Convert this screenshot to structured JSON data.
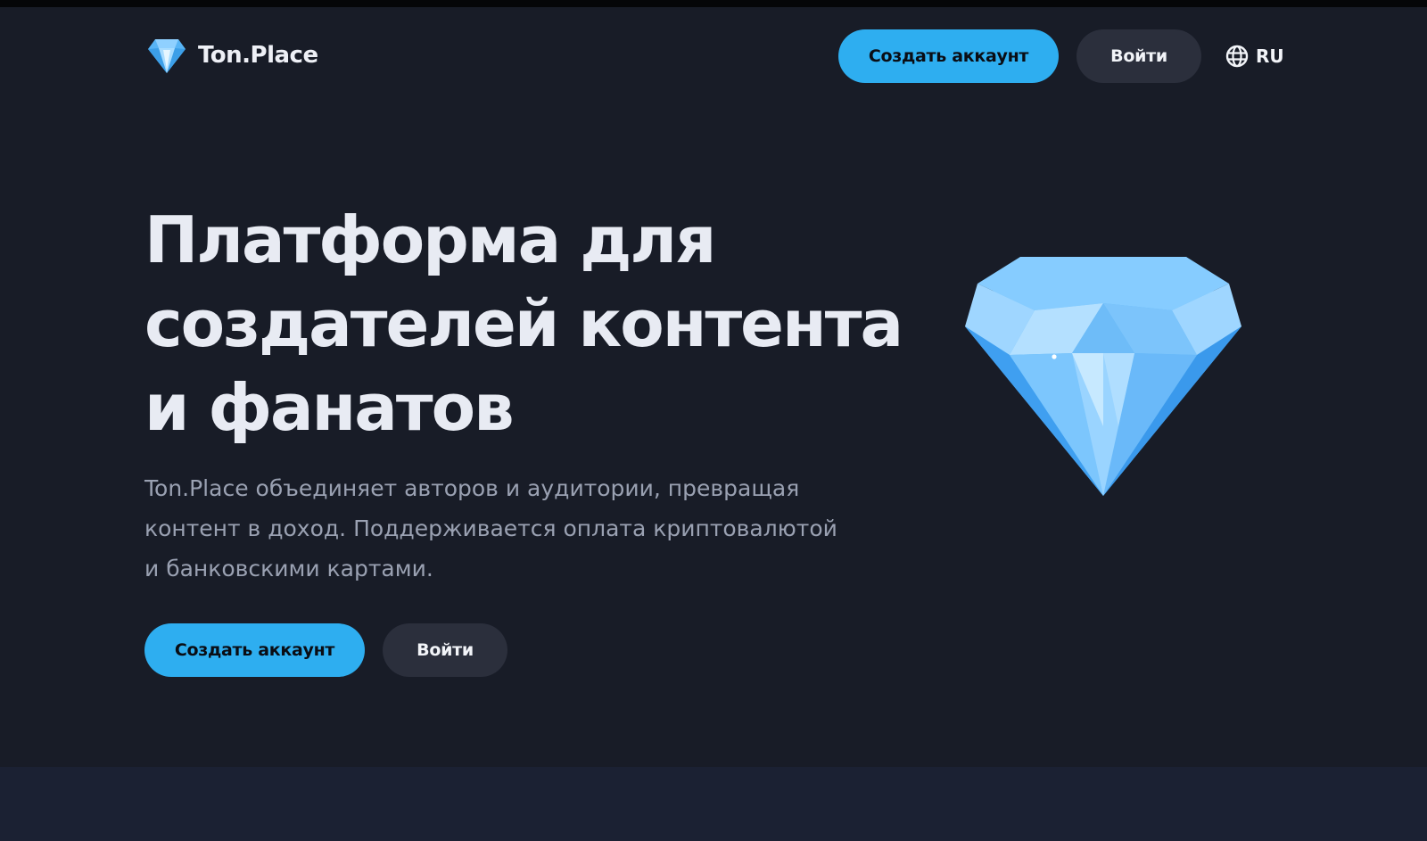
{
  "header": {
    "brand": "Ton.Place",
    "create_account": "Создать аккаунт",
    "login": "Войти",
    "language": "RU"
  },
  "hero": {
    "title_lines": [
      "Платформа для",
      "создателей контента",
      "и фанатов"
    ],
    "subtitle_lines": [
      "Ton.Place объединяет авторов и аудитории, превращая",
      "контент в доход. Поддерживается оплата криптовалютой",
      "и банковскими картами."
    ],
    "create_account": "Создать аккаунт",
    "login": "Войти"
  },
  "icons": {
    "logo": "diamond-icon",
    "language": "globe-icon",
    "hero_illustration": "diamond-illustration"
  },
  "colors": {
    "background": "#181c27",
    "accent": "#2eaef0",
    "secondary_button": "#2b2f3c",
    "title_text": "#e8ebf3",
    "subtitle_text": "#9aa1b2"
  }
}
